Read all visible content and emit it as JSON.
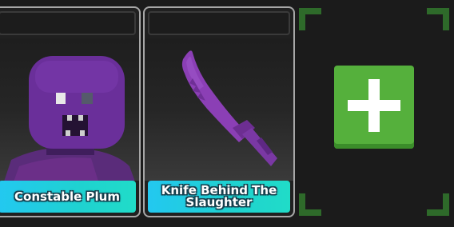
{
  "inventory": {
    "items": [
      {
        "name": "Constable Plum",
        "type": "character"
      },
      {
        "name": "Knife Behind The Slaughter",
        "type": "weapon"
      }
    ],
    "add_slot": {
      "icon": "plus-icon",
      "color": "#55b03c",
      "corner_color": "#2e6a2a"
    }
  }
}
